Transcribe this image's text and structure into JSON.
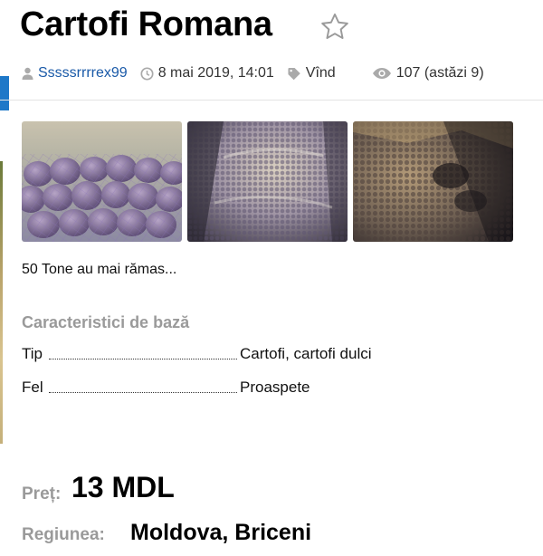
{
  "ad": {
    "title": "Cartofi Romana",
    "favorite_icon": "star-outline-icon"
  },
  "meta": {
    "user": "Sssssrrrrex99",
    "date": "8 mai 2019, 14:01",
    "type": "Vînd",
    "views": "107 (astăzi 9)",
    "icons": [
      "user-icon",
      "clock-icon",
      "tag-icon",
      "eye-icon"
    ]
  },
  "photos": [
    {
      "name": "potato-sack-photo-1"
    },
    {
      "name": "potato-sacks-photo-2"
    },
    {
      "name": "potato-sacks-photo-3"
    }
  ],
  "description": "50 Tone au mai rămas...",
  "characteristics": {
    "title": "Caracteristici de bază",
    "rows": [
      {
        "key": "Tip",
        "value": "Cartofi, cartofi dulci"
      },
      {
        "key": "Fel",
        "value": "Proaspete"
      }
    ]
  },
  "price": {
    "label": "Preț:",
    "value": "13 MDL"
  },
  "region": {
    "label": "Regiunea:",
    "value": "Moldova, Briceni"
  },
  "colors": {
    "link": "#1a5aa8",
    "muted_label": "#9a9a9a",
    "edge_tab": "#1e78c8"
  }
}
